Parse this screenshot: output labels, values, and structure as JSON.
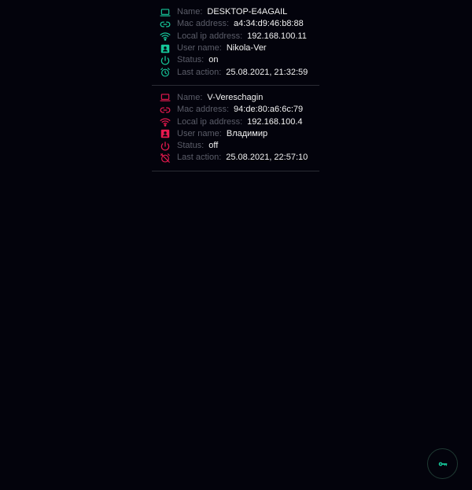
{
  "colors": {
    "background": "#03030c",
    "online_accent": "#16c79a",
    "offline_accent": "#e8194f",
    "label": "#5b5d69",
    "value": "#f2f2f2"
  },
  "labels": {
    "name": "Name:",
    "mac": "Mac address:",
    "ip": "Local ip address:",
    "user": "User name:",
    "status": "Status:",
    "last_action": "Last action:"
  },
  "devices": [
    {
      "state": "online",
      "name": "DESKTOP-E4AGAIL",
      "mac": "a4:34:d9:46:b8:88",
      "ip": "192.168.100.11",
      "user": "Nikola-Ver",
      "status": "on",
      "last_action": "25.08.2021, 21:32:59",
      "icons": [
        "laptop-icon",
        "link-icon",
        "wifi-icon",
        "user-badge-icon",
        "power-icon",
        "alarm-clock-icon"
      ]
    },
    {
      "state": "offline",
      "name": "V-Vereschagin",
      "mac": "94:de:80:a6:6c:79",
      "ip": "192.168.100.4",
      "user": "Владимир",
      "status": "off",
      "last_action": "25.08.2021, 22:57:10",
      "icons": [
        "laptop-icon",
        "link-icon",
        "wifi-icon",
        "user-badge-icon",
        "power-icon",
        "alarm-off-icon"
      ]
    }
  ],
  "fab": {
    "icon": "key-icon"
  }
}
